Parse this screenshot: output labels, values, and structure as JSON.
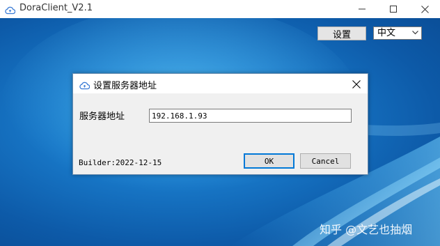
{
  "window": {
    "title": "DoraClient_V2.1",
    "icon": "cloud-icon"
  },
  "toolbar": {
    "settings_label": "设置",
    "language_value": "中文"
  },
  "dialog": {
    "title": "设置服务器地址",
    "server_label": "服务器地址",
    "server_value": "192.168.1.93",
    "builder_text": "Builder:2022-12-15",
    "ok_label": "OK",
    "cancel_label": "Cancel"
  },
  "watermark": "知乎 @文艺也抽烟",
  "colors": {
    "desktop_blue": "#1878c8",
    "accent_border": "#0078d7",
    "dialog_bg": "#f0f0f0"
  }
}
